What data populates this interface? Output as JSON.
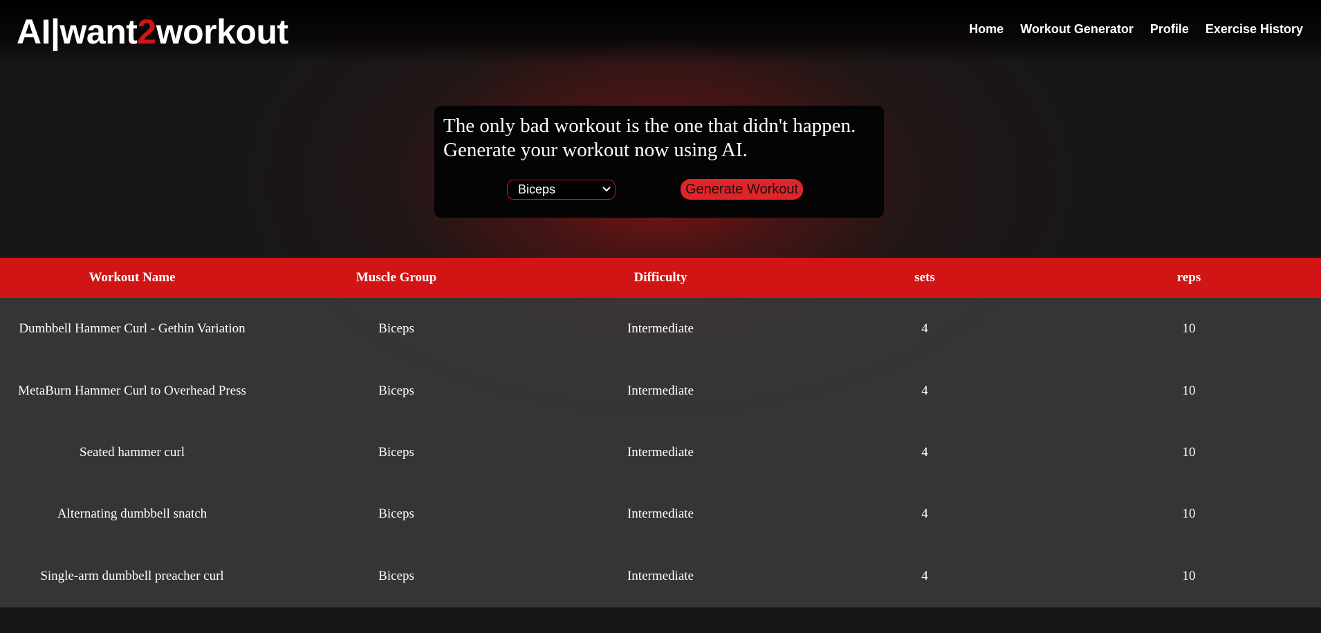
{
  "brand": {
    "logo_part1": "AI|want",
    "logo_accent": "2",
    "logo_part2": "workout",
    "accent_color": "#d11515"
  },
  "nav": {
    "items": [
      {
        "label": "Home"
      },
      {
        "label": "Workout Generator"
      },
      {
        "label": "Profile"
      },
      {
        "label": "Exercise History"
      }
    ]
  },
  "generator": {
    "tagline_line1": "The only bad workout is the one that didn't happen.",
    "tagline_line2": "Generate your workout now using AI.",
    "muscle_select_value": "Biceps",
    "button_label": "Generate Workout",
    "button_color": "#e0252a"
  },
  "table": {
    "headers": [
      "Workout Name",
      "Muscle Group",
      "Difficulty",
      "sets",
      "reps"
    ],
    "header_color": "#d11515",
    "rows": [
      [
        "Dumbbell Hammer Curl - Gethin Variation",
        "Biceps",
        "Intermediate",
        "4",
        "10"
      ],
      [
        "MetaBurn Hammer Curl to Overhead Press",
        "Biceps",
        "Intermediate",
        "4",
        "10"
      ],
      [
        "Seated hammer curl",
        "Biceps",
        "Intermediate",
        "4",
        "10"
      ],
      [
        "Alternating dumbbell snatch",
        "Biceps",
        "Intermediate",
        "4",
        "10"
      ],
      [
        "Single-arm dumbbell preacher curl",
        "Biceps",
        "Intermediate",
        "4",
        "10"
      ]
    ]
  }
}
